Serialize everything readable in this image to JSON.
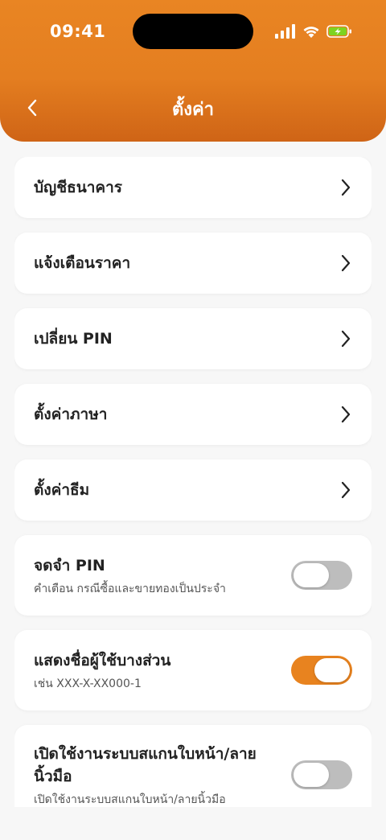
{
  "status_bar": {
    "time": "09:41"
  },
  "colors": {
    "header": "#e47e20",
    "toggle_on": "#e8831f",
    "toggle_off": "#bdbdbd",
    "battery": "#7ed321"
  },
  "nav": {
    "title": "ตั้งค่า",
    "back_icon": "chevron-left-icon"
  },
  "menu_items": [
    {
      "label": "บัญชีธนาคาร"
    },
    {
      "label": "แจ้งเตือนราคา"
    },
    {
      "label": "เปลี่ยน PIN"
    },
    {
      "label": "ตั้งค่าภาษา"
    },
    {
      "label": "ตั้งค่าธีม"
    }
  ],
  "toggles": [
    {
      "title": "จดจำ PIN",
      "description": "คำเตือน กรณีซื้อและขายทองเป็นประจำ",
      "on": false
    },
    {
      "title": "แสดงชื่อผู้ใช้บางส่วน",
      "description": "เช่น XXX-X-XX000-1",
      "on": true
    },
    {
      "title": "เปิดใช้งานระบบสแกนใบหน้า/ลายนิ้วมือ",
      "description": "เปิดใช้งานระบบสแกนใบหน้า/ลายนิ้วมือ",
      "on": false
    }
  ]
}
